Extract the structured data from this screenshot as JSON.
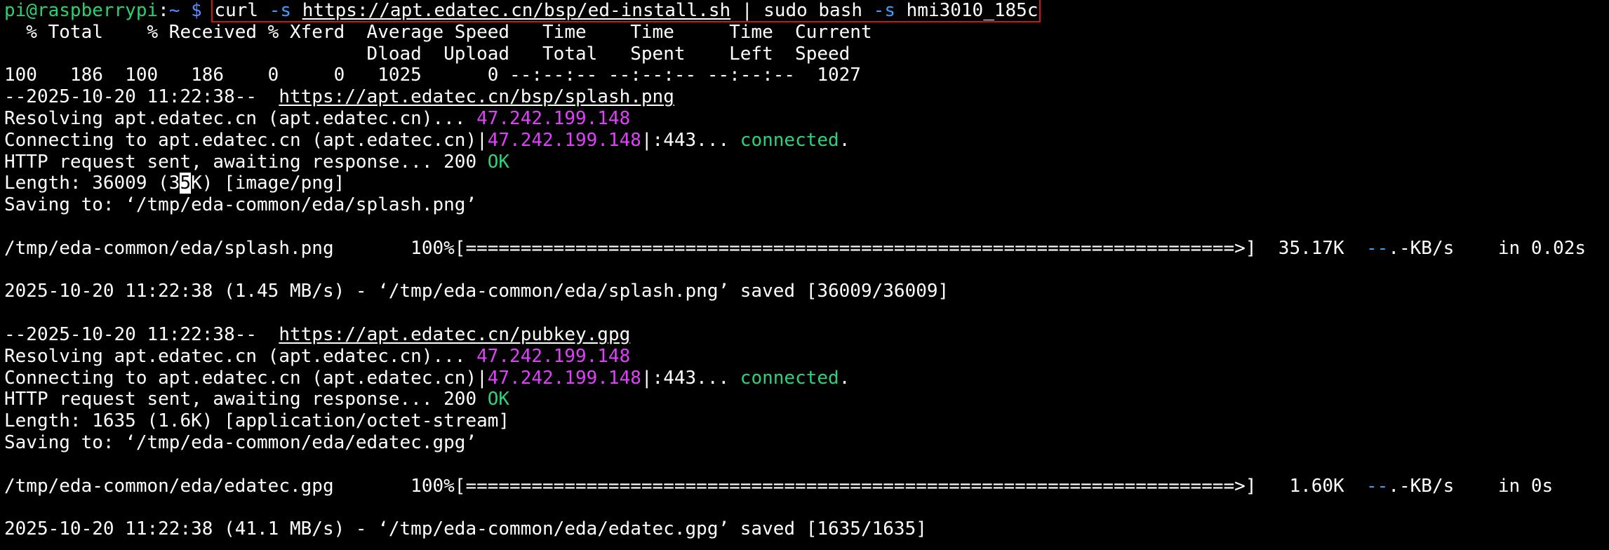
{
  "window": {
    "background": "#000000",
    "foreground": "#ffffff"
  },
  "colors": {
    "prompt_green": "#2ad36b",
    "prompt_blue": "#5b8cff",
    "option_blue": "#3aa0ff",
    "ip_magenta": "#e040fb",
    "ok_green": "#2ed27a",
    "box_red": "#d11414"
  },
  "lines": [
    {
      "segments": [
        {
          "text": "pi@raspberrypi",
          "color": "#2ad36b"
        },
        {
          "text": ":",
          "color": "#ffffff"
        },
        {
          "text": "~ $ ",
          "color": "#5b8cff"
        },
        {
          "text": "curl ",
          "color": "#ffffff",
          "boxStart": true
        },
        {
          "text": "-s ",
          "color": "#3aa0ff"
        },
        {
          "text": "https://apt.edatec.cn/bsp/ed-install.sh",
          "color": "#ffffff",
          "underline": true
        },
        {
          "text": " | sudo bash ",
          "color": "#ffffff"
        },
        {
          "text": "-s ",
          "color": "#3aa0ff"
        },
        {
          "text": "hmi3010_185c",
          "color": "#ffffff",
          "boxEnd": true
        }
      ]
    },
    {
      "segments": [
        {
          "text": "  % Total    % Received % Xferd  Average Speed   Time    Time     Time  Current",
          "color": "#ffffff"
        }
      ]
    },
    {
      "segments": [
        {
          "text": "                                 Dload  Upload   Total   Spent    Left  Speed",
          "color": "#ffffff"
        }
      ]
    },
    {
      "segments": [
        {
          "text": "100   186  100   186    0     0   1025      0 --:--:-- --:--:-- --:--:--  1027",
          "color": "#ffffff"
        }
      ]
    },
    {
      "segments": [
        {
          "text": "--2025-10-20 11:22:38--  ",
          "color": "#ffffff"
        },
        {
          "text": "https://apt.edatec.cn/bsp/splash.png",
          "color": "#ffffff",
          "underline": true
        }
      ]
    },
    {
      "segments": [
        {
          "text": "Resolving apt.edatec.cn (apt.edatec.cn)... ",
          "color": "#ffffff"
        },
        {
          "text": "47.242.199.148",
          "color": "#e040fb"
        }
      ]
    },
    {
      "segments": [
        {
          "text": "Connecting to apt.edatec.cn (apt.edatec.cn)|",
          "color": "#ffffff"
        },
        {
          "text": "47.242.199.148",
          "color": "#e040fb"
        },
        {
          "text": "|:443... ",
          "color": "#ffffff"
        },
        {
          "text": "connected",
          "color": "#2ed27a"
        },
        {
          "text": ".",
          "color": "#ffffff"
        }
      ]
    },
    {
      "segments": [
        {
          "text": "HTTP request sent, awaiting response... 200 ",
          "color": "#ffffff"
        },
        {
          "text": "OK",
          "color": "#2ed27a"
        }
      ]
    },
    {
      "segments": [
        {
          "text": "Length: 36009 (3",
          "color": "#ffffff"
        },
        {
          "text": "5",
          "color": "#000000",
          "cursor": true
        },
        {
          "text": "K) [image/png]",
          "color": "#ffffff"
        }
      ]
    },
    {
      "segments": [
        {
          "text": "Saving to: ‘/tmp/eda-common/eda/splash.png’",
          "color": "#ffffff"
        }
      ]
    },
    {
      "segments": [
        {
          "text": "",
          "color": "#ffffff"
        }
      ]
    },
    {
      "segments": [
        {
          "text": "/tmp/eda-common/eda/splash.png       100%[======================================================================>]  35.17K  ",
          "color": "#ffffff"
        },
        {
          "text": "--",
          "color": "#3aa0ff"
        },
        {
          "text": ".-KB/s    in 0.02s",
          "color": "#ffffff"
        }
      ]
    },
    {
      "segments": [
        {
          "text": "",
          "color": "#ffffff"
        }
      ]
    },
    {
      "segments": [
        {
          "text": "2025-10-20 11:22:38 (1.45 MB/s) - ‘/tmp/eda-common/eda/splash.png’ saved [36009/36009]",
          "color": "#ffffff"
        }
      ]
    },
    {
      "segments": [
        {
          "text": "",
          "color": "#ffffff"
        }
      ]
    },
    {
      "segments": [
        {
          "text": "--2025-10-20 11:22:38--  ",
          "color": "#ffffff"
        },
        {
          "text": "https://apt.edatec.cn/pubkey.gpg",
          "color": "#ffffff",
          "underline": true
        }
      ]
    },
    {
      "segments": [
        {
          "text": "Resolving apt.edatec.cn (apt.edatec.cn)... ",
          "color": "#ffffff"
        },
        {
          "text": "47.242.199.148",
          "color": "#e040fb"
        }
      ]
    },
    {
      "segments": [
        {
          "text": "Connecting to apt.edatec.cn (apt.edatec.cn)|",
          "color": "#ffffff"
        },
        {
          "text": "47.242.199.148",
          "color": "#e040fb"
        },
        {
          "text": "|:443... ",
          "color": "#ffffff"
        },
        {
          "text": "connected",
          "color": "#2ed27a"
        },
        {
          "text": ".",
          "color": "#ffffff"
        }
      ]
    },
    {
      "segments": [
        {
          "text": "HTTP request sent, awaiting response... 200 ",
          "color": "#ffffff"
        },
        {
          "text": "OK",
          "color": "#2ed27a"
        }
      ]
    },
    {
      "segments": [
        {
          "text": "Length: 1635 (1.6K) [application/octet-stream]",
          "color": "#ffffff"
        }
      ]
    },
    {
      "segments": [
        {
          "text": "Saving to: ‘/tmp/eda-common/eda/edatec.gpg’",
          "color": "#ffffff"
        }
      ]
    },
    {
      "segments": [
        {
          "text": "",
          "color": "#ffffff"
        }
      ]
    },
    {
      "segments": [
        {
          "text": "/tmp/eda-common/eda/edatec.gpg       100%[======================================================================>]   1.60K  ",
          "color": "#ffffff"
        },
        {
          "text": "--",
          "color": "#3aa0ff"
        },
        {
          "text": ".-KB/s    in 0s",
          "color": "#ffffff"
        }
      ]
    },
    {
      "segments": [
        {
          "text": "",
          "color": "#ffffff"
        }
      ]
    },
    {
      "segments": [
        {
          "text": "2025-10-20 11:22:38 (41.1 MB/s) - ‘/tmp/eda-common/eda/edatec.gpg’ saved [1635/1635]",
          "color": "#ffffff"
        }
      ]
    }
  ]
}
